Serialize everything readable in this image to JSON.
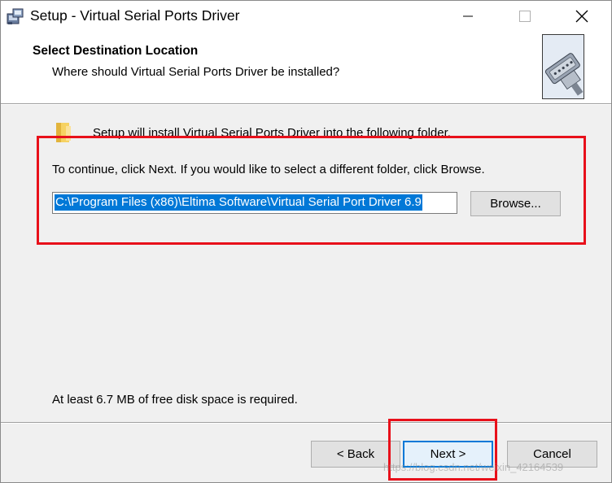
{
  "window": {
    "title": "Setup - Virtual Serial Ports Driver",
    "controls": {
      "minimize": "minimize-icon",
      "maximize": "maximize-icon",
      "close": "close-icon"
    }
  },
  "header": {
    "title": "Select Destination Location",
    "subtitle": "Where should Virtual Serial Ports Driver be installed?",
    "image": "serial-port-connector-icon"
  },
  "body": {
    "intro": "Setup will install Virtual Serial Ports Driver into the following folder.",
    "instruction": "To continue, click Next. If you would like to select a different folder, click Browse.",
    "path_value": "C:\\Program Files (x86)\\Eltima Software\\Virtual Serial Port Driver 6.9",
    "browse_label": "Browse...",
    "disk_space": "At least 6.7 MB of free disk space is required."
  },
  "footer": {
    "back_label": "< Back",
    "next_label": "Next >",
    "cancel_label": "Cancel"
  },
  "watermark": "https://blog.csdn.net/weixin_42164539",
  "colors": {
    "accent": "#0078d7",
    "annotation_red": "#e8101a",
    "background": "#f0f0f0"
  }
}
